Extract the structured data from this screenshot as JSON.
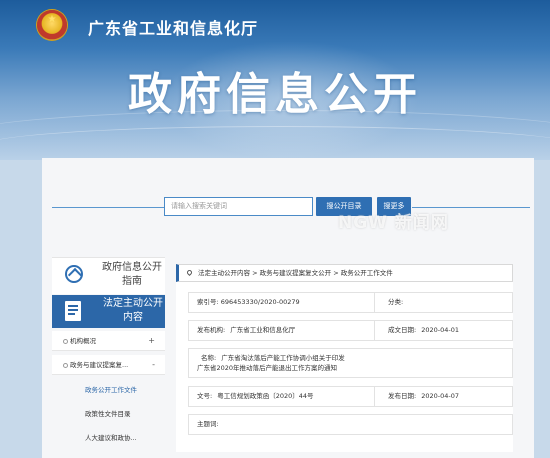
{
  "header": {
    "site_title": "广东省工业和信息化厅",
    "page_title": "政府信息公开"
  },
  "search": {
    "placeholder": "请输入搜索关键词",
    "directory_button": "搜公开目录",
    "more_button": "搜更多"
  },
  "watermark": "NGW 新闻网",
  "sidebar": {
    "guide_label": "政府信息公开指南",
    "active_label": "法定主动公开内容",
    "items": [
      {
        "label": "机构概况",
        "expand": "+"
      },
      {
        "label": "政务与建议提案复...",
        "expand": "-"
      }
    ],
    "sub_items": [
      {
        "label": "政务公开工作文件",
        "active": true
      },
      {
        "label": "政策性文件目录",
        "active": false
      },
      {
        "label": "人大建议和政协...",
        "active": false
      }
    ]
  },
  "breadcrumb": {
    "items": [
      "法定主动公开内容",
      "政务与建议提案复文公开",
      "政务公开工作文件"
    ],
    "separator": ">"
  },
  "doc_info": {
    "index_label": "索引号:",
    "index_value": "696453330/2020-00279",
    "category_label": "分类:",
    "category_value": "",
    "publisher_label": "发布机构:",
    "publisher_value": "广东省工业和信息化厅",
    "date_created_label": "成文日期:",
    "date_created_value": "2020-04-01",
    "name_label": "名称:",
    "name_line1": "广东省淘汰落后产能工作协调小组关于印发",
    "name_line2": "广东省2020年推动落后产能退出工作方案的通知",
    "doc_no_label": "文号:",
    "doc_no_value": "粤工信规划政策函〔2020〕44号",
    "publish_date_label": "发布日期:",
    "publish_date_value": "2020-04-07",
    "subject_label": "主题词:",
    "subject_value": ""
  },
  "colors": {
    "accent": "#2c67a8",
    "banner_top": "#1d5c9c",
    "panel_bg": "#f5f6f8"
  }
}
